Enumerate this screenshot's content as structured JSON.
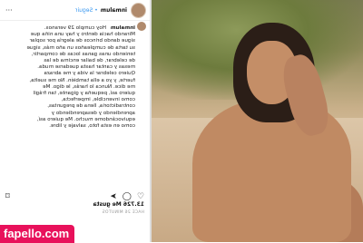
{
  "post": {
    "username": "inmalum",
    "follow_label": "• Seguir",
    "more_label": "···",
    "caption": "Hoy cumplo 29 veranos. Mirando hacia dentro y hay una niña que sigue dando brincos de alegría por soplar su tarta de cumpleaños un año más, sigue teniendo unas ganas locas de compartir, de celebrar, de bailar encima de las mesas y cantar hasta quedarse muda. Quiero celebrar la vida y me abraza fuerte, y yo a ella también. No me suelta, me dice. Nunca lo harás, le digo. Me quiero así, pequeña y gigante, tan frágil como invencible, imperfecta, contradictoria, llena de preguntas, aprendiendo y desaprendiendo y equivocándome mucho. Me quiero así, como en esta foto, salvaje y libre.",
    "likes": "13.726 Me gusta",
    "time_ago": "HACE 26 MINUTOS"
  },
  "watermark": "fapello.com",
  "colors": {
    "watermark_bg": "#e8115b",
    "link_blue": "#3897f0"
  }
}
